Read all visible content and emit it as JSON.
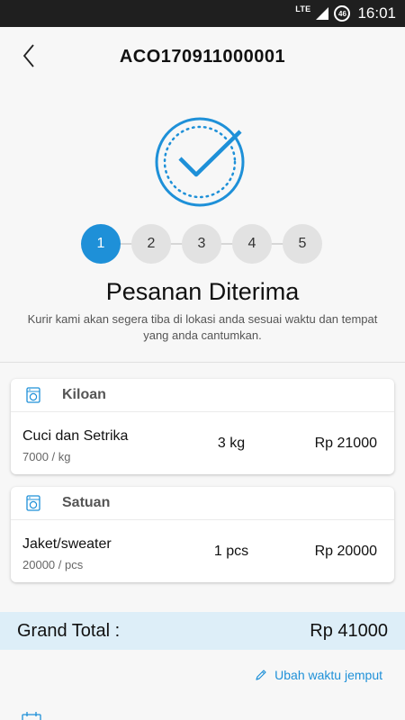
{
  "status_bar": {
    "network": "LTE",
    "badge": "46",
    "time": "16:01"
  },
  "header": {
    "order_id": "ACO170911000001",
    "back_icon": "chevron-left-icon"
  },
  "progress": {
    "steps": [
      "1",
      "2",
      "3",
      "4",
      "5"
    ],
    "active_step": 1,
    "hero_icon": "check-circle-icon"
  },
  "status": {
    "title": "Pesanan Diterima",
    "description": "Kurir kami akan segera tiba di lokasi anda sesuai waktu dan tempat yang anda cantumkan."
  },
  "sections": [
    {
      "title": "Kiloan",
      "icon": "washing-machine-icon",
      "items": [
        {
          "name": "Cuci dan Setrika",
          "unit_price": "7000 / kg",
          "qty": "3 kg",
          "total": "Rp 21000"
        }
      ]
    },
    {
      "title": "Satuan",
      "icon": "washing-machine-icon",
      "items": [
        {
          "name": "Jaket/sweater",
          "unit_price": "20000 / pcs",
          "qty": "1 pcs",
          "total": "Rp 20000"
        }
      ]
    }
  ],
  "summary": {
    "label": "Grand Total :",
    "value": "Rp 41000"
  },
  "actions": {
    "edit_pickup_label": "Ubah waktu jemput",
    "edit_icon": "pencil-icon"
  },
  "colors": {
    "accent": "#1e90d8",
    "status_bar": "#1f1f1f",
    "total_bg": "#ddeef8"
  }
}
